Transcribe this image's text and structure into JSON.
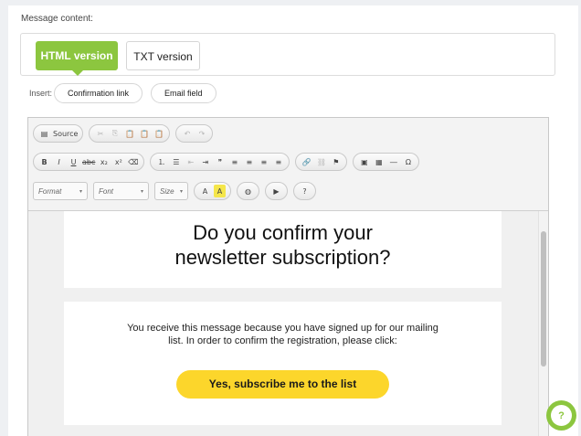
{
  "message": {
    "label": "Message content:"
  },
  "tabs": [
    {
      "label": "HTML version",
      "active": true
    },
    {
      "label": "TXT version",
      "active": false
    }
  ],
  "insert": {
    "label": "Insert:",
    "buttons": [
      "Confirmation link",
      "Email field"
    ]
  },
  "toolbar": {
    "row1": {
      "source_icon": "▤",
      "source_label": "Source",
      "cut": "✂",
      "copy": "⎘",
      "paste": "📋",
      "paste_text": "📋",
      "paste_word": "📋",
      "undo": "↶",
      "redo": "↷"
    },
    "row2": {
      "bold": "B",
      "italic": "I",
      "underline": "U",
      "strike": "abc",
      "subscript": "x₂",
      "superscript": "x²",
      "remove_format": "⌫",
      "ordered_list": "⒈",
      "bullet_list": "☰",
      "outdent": "⇤",
      "indent": "⇥",
      "blockquote": "❞",
      "align_left": "≡",
      "align_center": "≡",
      "align_right": "≡",
      "justify": "≡",
      "link": "🔗",
      "unlink": "⛓",
      "anchor": "⚑",
      "image": "▣",
      "table": "▦",
      "hr": "―",
      "special_char": "Ω"
    },
    "row3": {
      "format": "Format",
      "font": "Font",
      "size": "Size",
      "text_color": "A",
      "bg_color": "A",
      "globe": "◍",
      "video": "▶",
      "help": "?"
    }
  },
  "email": {
    "heading_line1": "Do you confirm your",
    "heading_line2": "newsletter subscription?",
    "body_line1": "You receive this message because you have signed up for our mailing",
    "body_line2": "list. In order to confirm the registration, please click:",
    "cta": "Yes, subscribe me to the list"
  },
  "help_widget": {
    "icon": "?"
  },
  "colors": {
    "accent_green": "#8cc63f",
    "cta_yellow": "#fcd62b"
  }
}
